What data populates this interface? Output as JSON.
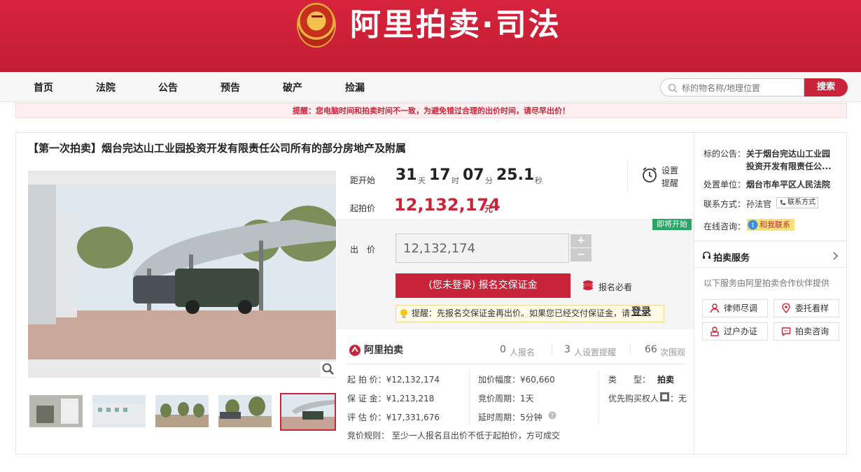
{
  "header": {
    "logo_text": "阿里拍卖·司法"
  },
  "nav": {
    "items": [
      {
        "label": "首页"
      },
      {
        "label": "法院"
      },
      {
        "label": "公告"
      },
      {
        "label": "预告"
      },
      {
        "label": "破产"
      },
      {
        "label": "捡漏"
      }
    ],
    "search_placeholder": "标的物名称/地理位置",
    "search_button": "搜索"
  },
  "notice": "提醒：您电脑时间和拍卖时间不一致，为避免错过合理的出价时间，请尽早出价！",
  "item": {
    "title": "【第一次拍卖】烟台完达山工业园投资开发有限责任公司所有的部分房地产及附属"
  },
  "countdown": {
    "label": "距开始",
    "days": "31",
    "days_unit": "天",
    "hours": "17",
    "hours_unit": "时",
    "minutes": "07",
    "minutes_unit": "分",
    "seconds": "25.1",
    "seconds_unit": "秒"
  },
  "remind": {
    "line1": "设置",
    "line2": "提醒"
  },
  "start_price": {
    "label": "起拍价",
    "value": "12,132,174",
    "unit": "元"
  },
  "bid": {
    "badge": "即将开始",
    "label": "出　价",
    "value": "12,132,174",
    "plus": "+",
    "minus": "−",
    "deposit_button": "(您未登录) 报名交保证金",
    "must_read": "报名必看",
    "tip_text": "提醒：先报名交保证金再出价。如果您已经交付保证金，请",
    "tip_link": "登录"
  },
  "stats": {
    "logo": "阿里拍卖",
    "signups": "0",
    "signups_label": "人报名",
    "reminders": "3",
    "reminders_label": "人设置提醒",
    "views": "66",
    "views_label": "次围观"
  },
  "details": {
    "start_price": "起 拍 价：¥12,132,174",
    "deposit": "保 证 金：¥1,213,218",
    "appraisal": "评 估 价：¥17,331,676",
    "increment": "加价幅度：¥60,660",
    "cycle": "竞价周期：1天",
    "delay": "延时周期：5分钟",
    "type_label": "类　　型：",
    "type_value": "拍卖",
    "priority": "优先购买权人",
    "priority_value": "：无",
    "rule": "竞价规则：  至少一人报名且出价不低于起拍价，方可成交"
  },
  "sidebar": {
    "announcement_label": "标的公告：",
    "announcement_value_1": "关于烟台完达山工业园",
    "announcement_value_2": "投资开发有限责任公...",
    "unit_label": "处置单位：",
    "unit_value": "烟台市牟平区人民法院",
    "contact_label": "联系方式：",
    "contact_value": "孙法官",
    "contact_button": "联系方式",
    "consult_label": "在线咨询：",
    "consult_button": "和我联系",
    "services_title": "拍卖服务",
    "services_desc": "以下服务由阿里拍卖合作伙伴提供",
    "services": [
      {
        "label": "律师尽调"
      },
      {
        "label": "委托看样"
      },
      {
        "label": "过户办证"
      },
      {
        "label": "拍卖咨询"
      }
    ]
  },
  "colors": {
    "brand_red": "#c8243a",
    "green_badge": "#2aa566"
  }
}
